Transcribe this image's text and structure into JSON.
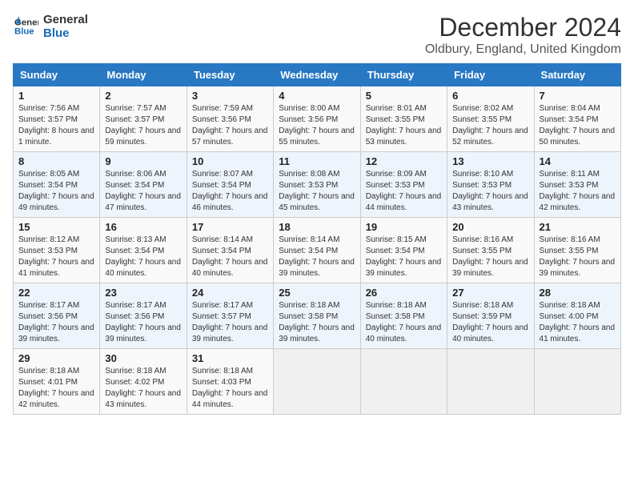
{
  "logo": {
    "line1": "General",
    "line2": "Blue"
  },
  "title": "December 2024",
  "location": "Oldbury, England, United Kingdom",
  "weekdays": [
    "Sunday",
    "Monday",
    "Tuesday",
    "Wednesday",
    "Thursday",
    "Friday",
    "Saturday"
  ],
  "weeks": [
    [
      {
        "day": "1",
        "sunrise": "Sunrise: 7:56 AM",
        "sunset": "Sunset: 3:57 PM",
        "daylight": "Daylight: 8 hours and 1 minute."
      },
      {
        "day": "2",
        "sunrise": "Sunrise: 7:57 AM",
        "sunset": "Sunset: 3:57 PM",
        "daylight": "Daylight: 7 hours and 59 minutes."
      },
      {
        "day": "3",
        "sunrise": "Sunrise: 7:59 AM",
        "sunset": "Sunset: 3:56 PM",
        "daylight": "Daylight: 7 hours and 57 minutes."
      },
      {
        "day": "4",
        "sunrise": "Sunrise: 8:00 AM",
        "sunset": "Sunset: 3:56 PM",
        "daylight": "Daylight: 7 hours and 55 minutes."
      },
      {
        "day": "5",
        "sunrise": "Sunrise: 8:01 AM",
        "sunset": "Sunset: 3:55 PM",
        "daylight": "Daylight: 7 hours and 53 minutes."
      },
      {
        "day": "6",
        "sunrise": "Sunrise: 8:02 AM",
        "sunset": "Sunset: 3:55 PM",
        "daylight": "Daylight: 7 hours and 52 minutes."
      },
      {
        "day": "7",
        "sunrise": "Sunrise: 8:04 AM",
        "sunset": "Sunset: 3:54 PM",
        "daylight": "Daylight: 7 hours and 50 minutes."
      }
    ],
    [
      {
        "day": "8",
        "sunrise": "Sunrise: 8:05 AM",
        "sunset": "Sunset: 3:54 PM",
        "daylight": "Daylight: 7 hours and 49 minutes."
      },
      {
        "day": "9",
        "sunrise": "Sunrise: 8:06 AM",
        "sunset": "Sunset: 3:54 PM",
        "daylight": "Daylight: 7 hours and 47 minutes."
      },
      {
        "day": "10",
        "sunrise": "Sunrise: 8:07 AM",
        "sunset": "Sunset: 3:54 PM",
        "daylight": "Daylight: 7 hours and 46 minutes."
      },
      {
        "day": "11",
        "sunrise": "Sunrise: 8:08 AM",
        "sunset": "Sunset: 3:53 PM",
        "daylight": "Daylight: 7 hours and 45 minutes."
      },
      {
        "day": "12",
        "sunrise": "Sunrise: 8:09 AM",
        "sunset": "Sunset: 3:53 PM",
        "daylight": "Daylight: 7 hours and 44 minutes."
      },
      {
        "day": "13",
        "sunrise": "Sunrise: 8:10 AM",
        "sunset": "Sunset: 3:53 PM",
        "daylight": "Daylight: 7 hours and 43 minutes."
      },
      {
        "day": "14",
        "sunrise": "Sunrise: 8:11 AM",
        "sunset": "Sunset: 3:53 PM",
        "daylight": "Daylight: 7 hours and 42 minutes."
      }
    ],
    [
      {
        "day": "15",
        "sunrise": "Sunrise: 8:12 AM",
        "sunset": "Sunset: 3:53 PM",
        "daylight": "Daylight: 7 hours and 41 minutes."
      },
      {
        "day": "16",
        "sunrise": "Sunrise: 8:13 AM",
        "sunset": "Sunset: 3:54 PM",
        "daylight": "Daylight: 7 hours and 40 minutes."
      },
      {
        "day": "17",
        "sunrise": "Sunrise: 8:14 AM",
        "sunset": "Sunset: 3:54 PM",
        "daylight": "Daylight: 7 hours and 40 minutes."
      },
      {
        "day": "18",
        "sunrise": "Sunrise: 8:14 AM",
        "sunset": "Sunset: 3:54 PM",
        "daylight": "Daylight: 7 hours and 39 minutes."
      },
      {
        "day": "19",
        "sunrise": "Sunrise: 8:15 AM",
        "sunset": "Sunset: 3:54 PM",
        "daylight": "Daylight: 7 hours and 39 minutes."
      },
      {
        "day": "20",
        "sunrise": "Sunrise: 8:16 AM",
        "sunset": "Sunset: 3:55 PM",
        "daylight": "Daylight: 7 hours and 39 minutes."
      },
      {
        "day": "21",
        "sunrise": "Sunrise: 8:16 AM",
        "sunset": "Sunset: 3:55 PM",
        "daylight": "Daylight: 7 hours and 39 minutes."
      }
    ],
    [
      {
        "day": "22",
        "sunrise": "Sunrise: 8:17 AM",
        "sunset": "Sunset: 3:56 PM",
        "daylight": "Daylight: 7 hours and 39 minutes."
      },
      {
        "day": "23",
        "sunrise": "Sunrise: 8:17 AM",
        "sunset": "Sunset: 3:56 PM",
        "daylight": "Daylight: 7 hours and 39 minutes."
      },
      {
        "day": "24",
        "sunrise": "Sunrise: 8:17 AM",
        "sunset": "Sunset: 3:57 PM",
        "daylight": "Daylight: 7 hours and 39 minutes."
      },
      {
        "day": "25",
        "sunrise": "Sunrise: 8:18 AM",
        "sunset": "Sunset: 3:58 PM",
        "daylight": "Daylight: 7 hours and 39 minutes."
      },
      {
        "day": "26",
        "sunrise": "Sunrise: 8:18 AM",
        "sunset": "Sunset: 3:58 PM",
        "daylight": "Daylight: 7 hours and 40 minutes."
      },
      {
        "day": "27",
        "sunrise": "Sunrise: 8:18 AM",
        "sunset": "Sunset: 3:59 PM",
        "daylight": "Daylight: 7 hours and 40 minutes."
      },
      {
        "day": "28",
        "sunrise": "Sunrise: 8:18 AM",
        "sunset": "Sunset: 4:00 PM",
        "daylight": "Daylight: 7 hours and 41 minutes."
      }
    ],
    [
      {
        "day": "29",
        "sunrise": "Sunrise: 8:18 AM",
        "sunset": "Sunset: 4:01 PM",
        "daylight": "Daylight: 7 hours and 42 minutes."
      },
      {
        "day": "30",
        "sunrise": "Sunrise: 8:18 AM",
        "sunset": "Sunset: 4:02 PM",
        "daylight": "Daylight: 7 hours and 43 minutes."
      },
      {
        "day": "31",
        "sunrise": "Sunrise: 8:18 AM",
        "sunset": "Sunset: 4:03 PM",
        "daylight": "Daylight: 7 hours and 44 minutes."
      },
      null,
      null,
      null,
      null
    ]
  ]
}
